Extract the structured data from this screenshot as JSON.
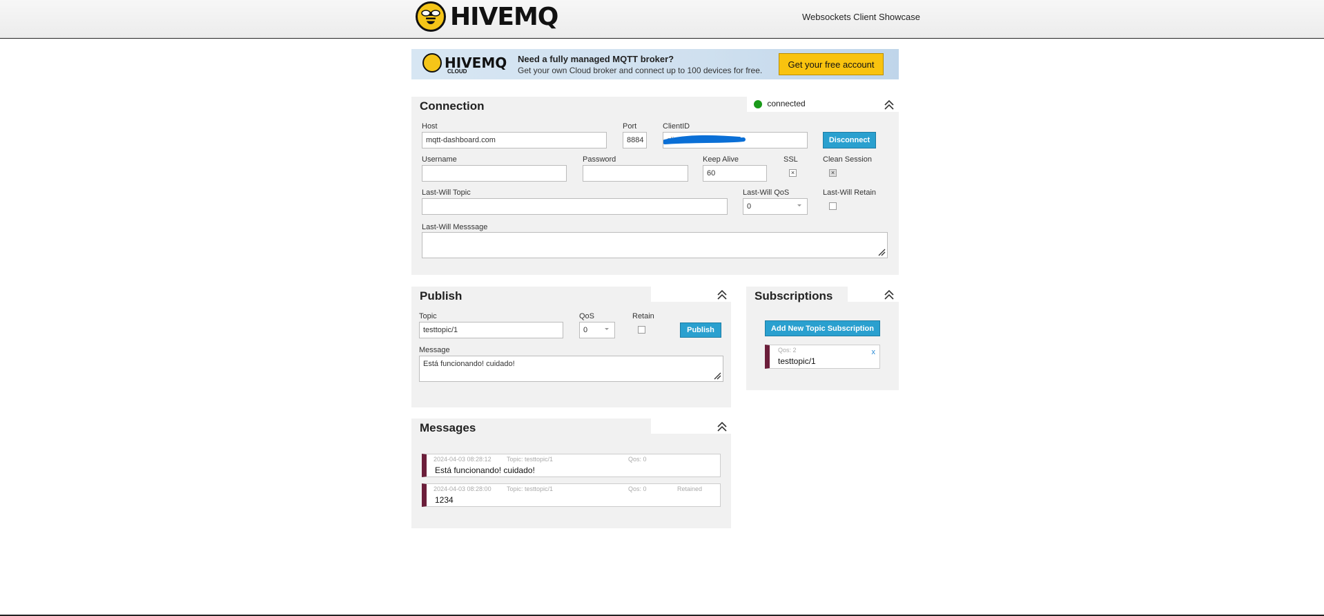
{
  "header": {
    "brand": "HIVEMQ",
    "subtitle": "Websockets Client Showcase"
  },
  "banner": {
    "brand": "HIVEMQ",
    "brand_sub": "CLOUD",
    "headline": "Need a fully managed MQTT broker?",
    "subline": "Get your own Cloud broker and connect up to 100 devices for free.",
    "cta": "Get your free account"
  },
  "connection": {
    "title": "Connection",
    "status": "connected",
    "status_color": "#1a9a1a",
    "host_label": "Host",
    "host_value": "mqtt-dashboard.com",
    "port_label": "Port",
    "port_value": "8884",
    "clientid_label": "ClientID",
    "clientid_value": "clientId-",
    "disconnect_label": "Disconnect",
    "username_label": "Username",
    "username_value": "",
    "password_label": "Password",
    "password_value": "",
    "keepalive_label": "Keep Alive",
    "keepalive_value": "60",
    "ssl_label": "SSL",
    "ssl_checked": "×",
    "clean_label": "Clean Session",
    "clean_checked": "×",
    "lwt_topic_label": "Last-Will Topic",
    "lwt_topic_value": "",
    "lwt_qos_label": "Last-Will QoS",
    "lwt_qos_value": "0",
    "lwt_retain_label": "Last-Will Retain",
    "lwt_message_label": "Last-Will Messsage",
    "lwt_message_value": ""
  },
  "publish": {
    "title": "Publish",
    "topic_label": "Topic",
    "topic_value": "testtopic/1",
    "qos_label": "QoS",
    "qos_value": "0",
    "retain_label": "Retain",
    "publish_label": "Publish",
    "message_label": "Message",
    "message_value": "Está funcionando! cuidado!"
  },
  "subscriptions": {
    "title": "Subscriptions",
    "add_label": "Add New Topic Subscription",
    "items": [
      {
        "qos": "Qos: 2",
        "topic": "testtopic/1",
        "remove": "x",
        "color": "#6b1e3a"
      }
    ]
  },
  "messages": {
    "title": "Messages",
    "items": [
      {
        "time": "2024-04-03 08:28:12",
        "topic": "Topic: testtopic/1",
        "qos": "Qos: 0",
        "retained": "",
        "body": "Está funcionando! cuidado!"
      },
      {
        "time": "2024-04-03 08:28:00",
        "topic": "Topic: testtopic/1",
        "qos": "Qos: 0",
        "retained": "Retained",
        "body": "1234"
      }
    ]
  }
}
